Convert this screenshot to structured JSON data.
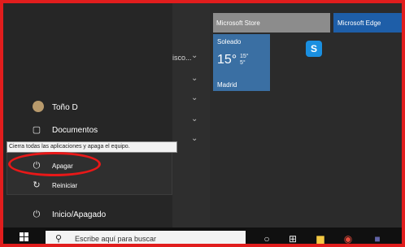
{
  "tiles": {
    "store_label": "Microsoft Store",
    "edge_label": "Microsoft Edge",
    "weather": {
      "condition": "Soleado",
      "temp": "15°",
      "high": "15°",
      "low": "5°",
      "city": "Madrid"
    },
    "skype_glyph": "S"
  },
  "app_list": {
    "truncated_label": "isco..."
  },
  "left_menu": {
    "user": "Toño D",
    "documents": "Documentos",
    "power": "Inicio/Apagado"
  },
  "power_menu": {
    "tooltip": "Cierra todas las aplicaciones y apaga el equipo.",
    "shutdown": "Apagar",
    "restart": "Reiniciar"
  },
  "taskbar": {
    "search_placeholder": "Escribe aquí para buscar"
  },
  "icons": {
    "windows": "windows-logo-icon",
    "search": "search-icon",
    "power": "power-icon",
    "document": "document-icon",
    "chevron": "chevron-down-icon",
    "cortana": "cortana-icon",
    "taskview": "task-view-icon",
    "explorer": "file-explorer-icon",
    "chrome": "chrome-icon",
    "teams": "teams-icon"
  },
  "colors": {
    "border": "#e11d1d",
    "edge_tile": "#1e5ea8",
    "weather_tile": "#3a6fa3",
    "store_tile": "#8c8c8c"
  }
}
